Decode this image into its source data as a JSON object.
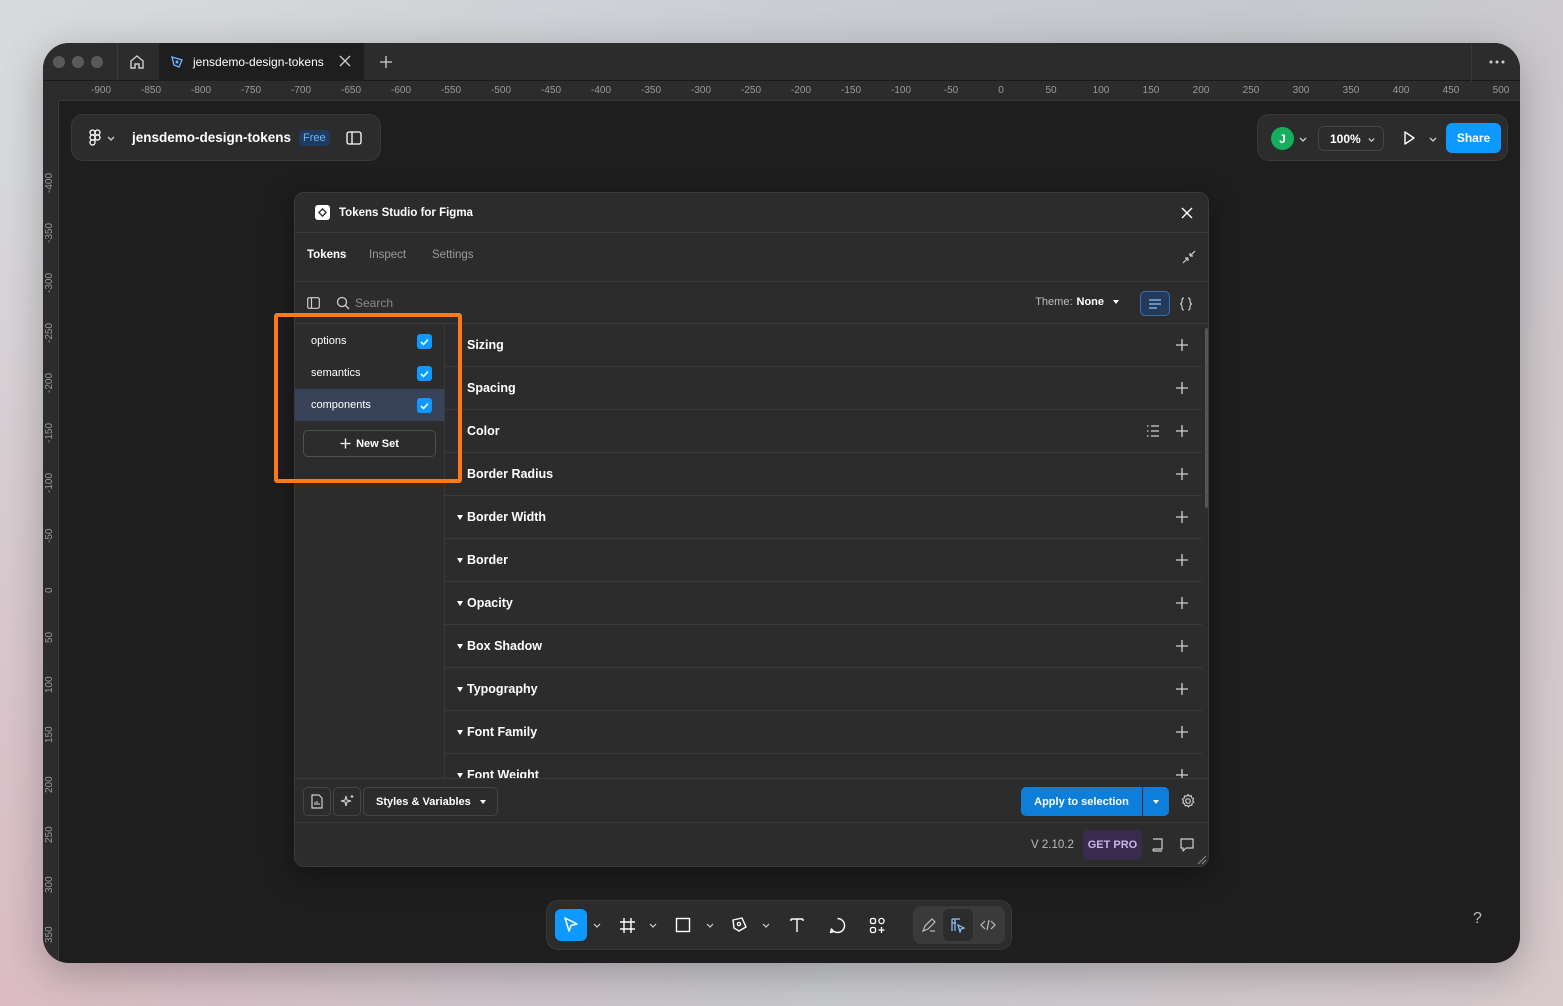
{
  "window": {
    "tab_title": "jensdemo-design-tokens"
  },
  "ruler": {
    "top_labels": [
      "-900",
      "-850",
      "-800",
      "-750",
      "-700",
      "-650",
      "-600",
      "-550",
      "-500",
      "-450",
      "-400",
      "-350",
      "-300",
      "-250",
      "-200",
      "-150",
      "-100",
      "-50",
      "0",
      "50",
      "100",
      "150",
      "200",
      "250",
      "300",
      "350",
      "400",
      "450",
      "500"
    ],
    "left_labels": [
      "-400",
      "-350",
      "-300",
      "-250",
      "-200",
      "-150",
      "-100",
      "-50",
      "0",
      "50",
      "100",
      "150",
      "200",
      "250",
      "300",
      "350"
    ]
  },
  "file": {
    "name": "jensdemo-design-tokens",
    "plan_badge": "Free"
  },
  "header_right": {
    "avatar_initial": "J",
    "zoom": "100%",
    "share_label": "Share"
  },
  "plugin": {
    "title": "Tokens Studio for Figma",
    "tabs": [
      {
        "label": "Tokens",
        "active": true
      },
      {
        "label": "Inspect",
        "active": false
      },
      {
        "label": "Settings",
        "active": false
      }
    ],
    "search_placeholder": "Search",
    "theme_label": "Theme:",
    "theme_value": "None",
    "sets": [
      {
        "label": "options",
        "checked": true
      },
      {
        "label": "semantics",
        "checked": true
      },
      {
        "label": "components",
        "checked": true
      }
    ],
    "new_set_label": "New Set",
    "token_groups": [
      {
        "name": "Sizing",
        "expanded": false
      },
      {
        "name": "Spacing",
        "expanded": false
      },
      {
        "name": "Color",
        "expanded": false
      },
      {
        "name": "Border Radius",
        "expanded": false
      },
      {
        "name": "Border Width",
        "expanded": true
      },
      {
        "name": "Border",
        "expanded": true
      },
      {
        "name": "Opacity",
        "expanded": true
      },
      {
        "name": "Box Shadow",
        "expanded": true
      },
      {
        "name": "Typography",
        "expanded": true
      },
      {
        "name": "Font Family",
        "expanded": true
      },
      {
        "name": "Font Weight",
        "expanded": true
      }
    ],
    "styles_dropdown": "Styles & Variables",
    "apply_label": "Apply to selection",
    "version": "V 2.10.2",
    "get_pro": "GET PRO"
  },
  "help_label": "?",
  "colors": {
    "accent": "#0d99ff",
    "highlight": "#ff7a14",
    "avatar": "#14ae5c"
  }
}
